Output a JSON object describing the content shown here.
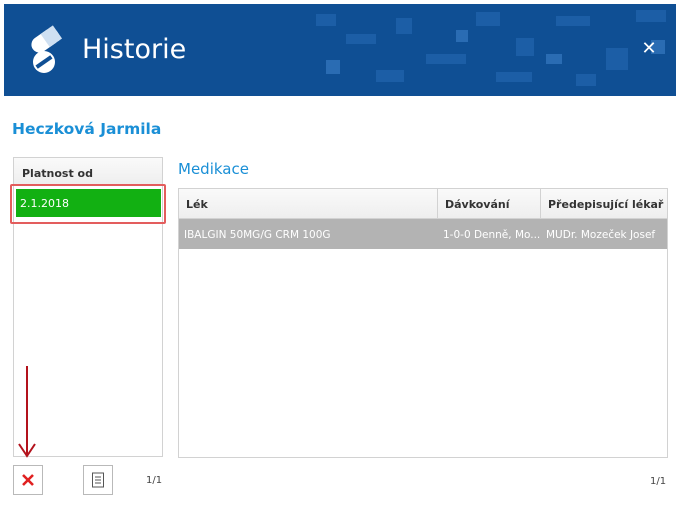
{
  "window": {
    "title": "Historie",
    "close_glyph": "✕",
    "logo_icon": "pills-icon",
    "header_color": "#0f4f94"
  },
  "patient": {
    "name": "Heczková Jarmila"
  },
  "validity": {
    "column_header": "Platnost od",
    "rows": [
      "2.1.2018"
    ],
    "selected_color": "#12b012",
    "pager": "1/1"
  },
  "medication": {
    "title": "Medikace",
    "columns": [
      "Lék",
      "Dávkování",
      "Předepisující lékař"
    ],
    "rows": [
      [
        "IBALGIN 50MG/G CRM 100G",
        "1-0-0 Denně, Mo...",
        "MUDr. Mozeček Josef"
      ]
    ],
    "pager": "1/1"
  },
  "toolbar": {
    "delete_icon": "delete-x-icon",
    "document_icon": "document-icon"
  },
  "annotations": {
    "highlight_color": "#e35d5d",
    "arrow_color": "#b3121c"
  }
}
